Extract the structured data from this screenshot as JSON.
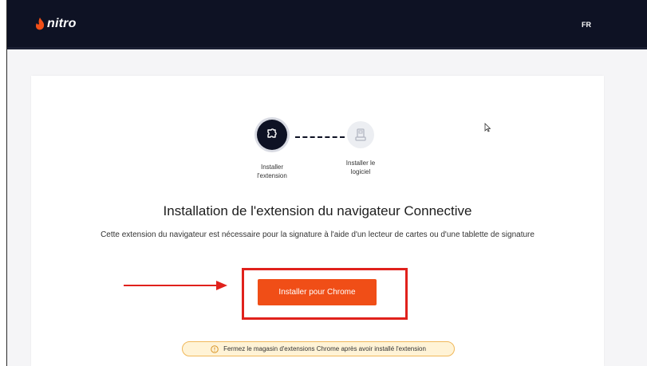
{
  "header": {
    "logo_text": "nitro",
    "language": "FR"
  },
  "steps": [
    {
      "label_line1": "Installer",
      "label_line2": "l'extension",
      "icon": "puzzle-icon",
      "state": "active"
    },
    {
      "label_line1": "Installer le",
      "label_line2": "logiciel",
      "icon": "card-reader-icon",
      "state": "pending"
    }
  ],
  "main": {
    "title": "Installation de l'extension du navigateur Connective",
    "description": "Cette extension du navigateur est nécessaire pour la signature à l'aide d'un lecteur de cartes ou d'une tablette de signature",
    "install_button": "Installer pour Chrome",
    "notice": "Fermez le magasin d'extensions Chrome après avoir installé l'extension"
  },
  "colors": {
    "header_bg": "#0e1224",
    "accent": "#f04e17",
    "annotation": "#e0211c",
    "notice_bg": "#fff3d6",
    "notice_border": "#f0b85a"
  }
}
